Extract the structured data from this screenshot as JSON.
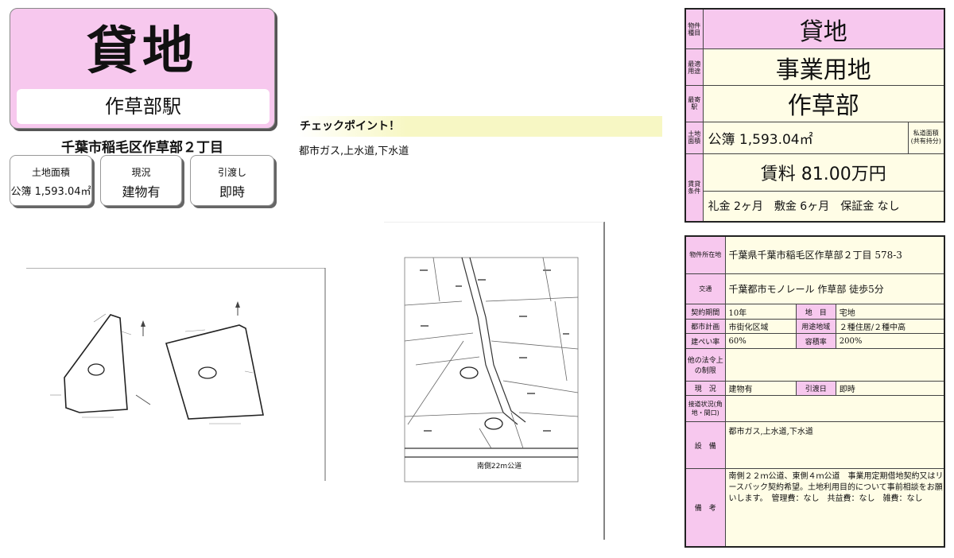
{
  "header": {
    "title": "貸地",
    "station": "作草部駅",
    "address": "千葉市稲毛区作草部２丁目"
  },
  "info_boxes": [
    {
      "label": "土地面積",
      "value": "公簿 1,593.04㎡"
    },
    {
      "label": "現況",
      "value": "建物有"
    },
    {
      "label": "引渡し",
      "value": "即時"
    }
  ],
  "checkpoint": {
    "heading": "チェックポイント！",
    "text": "都市ガス,上水道,下水道"
  },
  "drawing": {
    "road_label": "南側22m公道"
  },
  "summary": {
    "type_label": "物件種目",
    "type": "貸地",
    "use_label": "最適用途",
    "use": "事業用地",
    "station_label": "最寄駅",
    "station": "作草部",
    "area_label": "土地面積",
    "area": "公簿 1,593.04㎡",
    "area_note": "私道面積\n(共有持分)",
    "rent_label": "賃貸条件",
    "rent": "賃料 81.00万円",
    "terms": "礼金 2ヶ月　敷金 6ヶ月　保証金 なし"
  },
  "details": {
    "location_label": "物件所在地",
    "location": "千葉県千葉市稲毛区作草部２丁目 578-3",
    "transport_label": "交通",
    "transport": "千葉都市モノレール 作草部 徒歩5分",
    "contract_label": "契約期間",
    "contract": "10年",
    "land_label": "地　目",
    "land": "宅地",
    "plan_label": "都市計画",
    "plan": "市街化区域",
    "zone_label": "用途地域",
    "zone": "２種住居/２種中高",
    "bcr_label": "建ぺい率",
    "bcr": "60%",
    "far_label": "容積率",
    "far": "200%",
    "legal_label": "他の法令上の制限",
    "legal": "",
    "status_label": "現　況",
    "status": "建物有",
    "handover_label": "引渡日",
    "handover": "即時",
    "road_label": "接道状況(角地・間口)",
    "road": "",
    "facility_label": "設　備",
    "facility": "都市ガス,上水道,下水道",
    "remarks_label": "備　考",
    "remarks": "南側２２ｍ公道、東側４ｍ公道　事業用定期借地契約又はリースバック契約希望。土地利用目的について事前相談をお願いします。　管理費：なし　共益費：なし　雑費：なし"
  }
}
